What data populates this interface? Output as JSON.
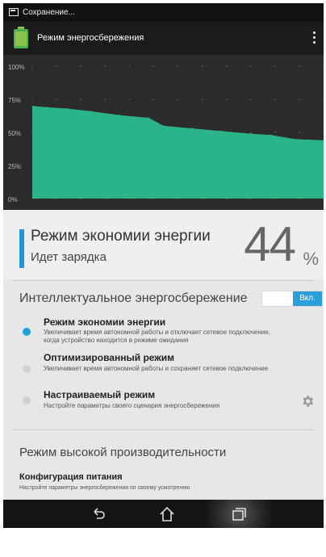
{
  "statusbar": {
    "text": "Сохранение..."
  },
  "appbar": {
    "title": "Режим энергосбережения"
  },
  "chart_data": {
    "type": "area",
    "yticks": [
      "100%",
      "75%",
      "50%",
      "25%",
      "0%"
    ],
    "ylim": [
      0,
      100
    ],
    "x": [
      0,
      5,
      12,
      20,
      30,
      40,
      45,
      55,
      65,
      75,
      82,
      90,
      100
    ],
    "values": [
      70,
      69,
      68,
      66,
      63,
      61,
      55,
      53,
      51,
      49,
      48,
      45,
      44
    ],
    "fill_color": "#2bb38a",
    "grid": true
  },
  "summary": {
    "mode": "Режим экономии энергии",
    "status": "Идет зарядка",
    "percent": "44",
    "percent_sign": "%"
  },
  "smart": {
    "title": "Интеллектуальное энергосбережение",
    "toggle": "Вкл."
  },
  "options": [
    {
      "title": "Режим экономии энергии",
      "desc": "Увеличивает время автономной работы и отключает сетевое подключение, когда устройство находится в режиме ожидания",
      "selected": true
    },
    {
      "title": "Оптимизированный режим",
      "desc": "Увеличивает время автономной работы и сохраняет сетевое подключение",
      "selected": false
    },
    {
      "title": "Настраиваемый режим",
      "desc": "Настройте параметры своего сценария энергосбережения",
      "selected": false
    }
  ],
  "performance": {
    "title": "Режим высокой производительности"
  },
  "config": {
    "title": "Конфигурация питания",
    "desc": "Настройте параметры энергосбережения по своему усмотрению"
  },
  "colors": {
    "accent": "#2a9fd8",
    "chart_fill": "#2bb38a"
  }
}
